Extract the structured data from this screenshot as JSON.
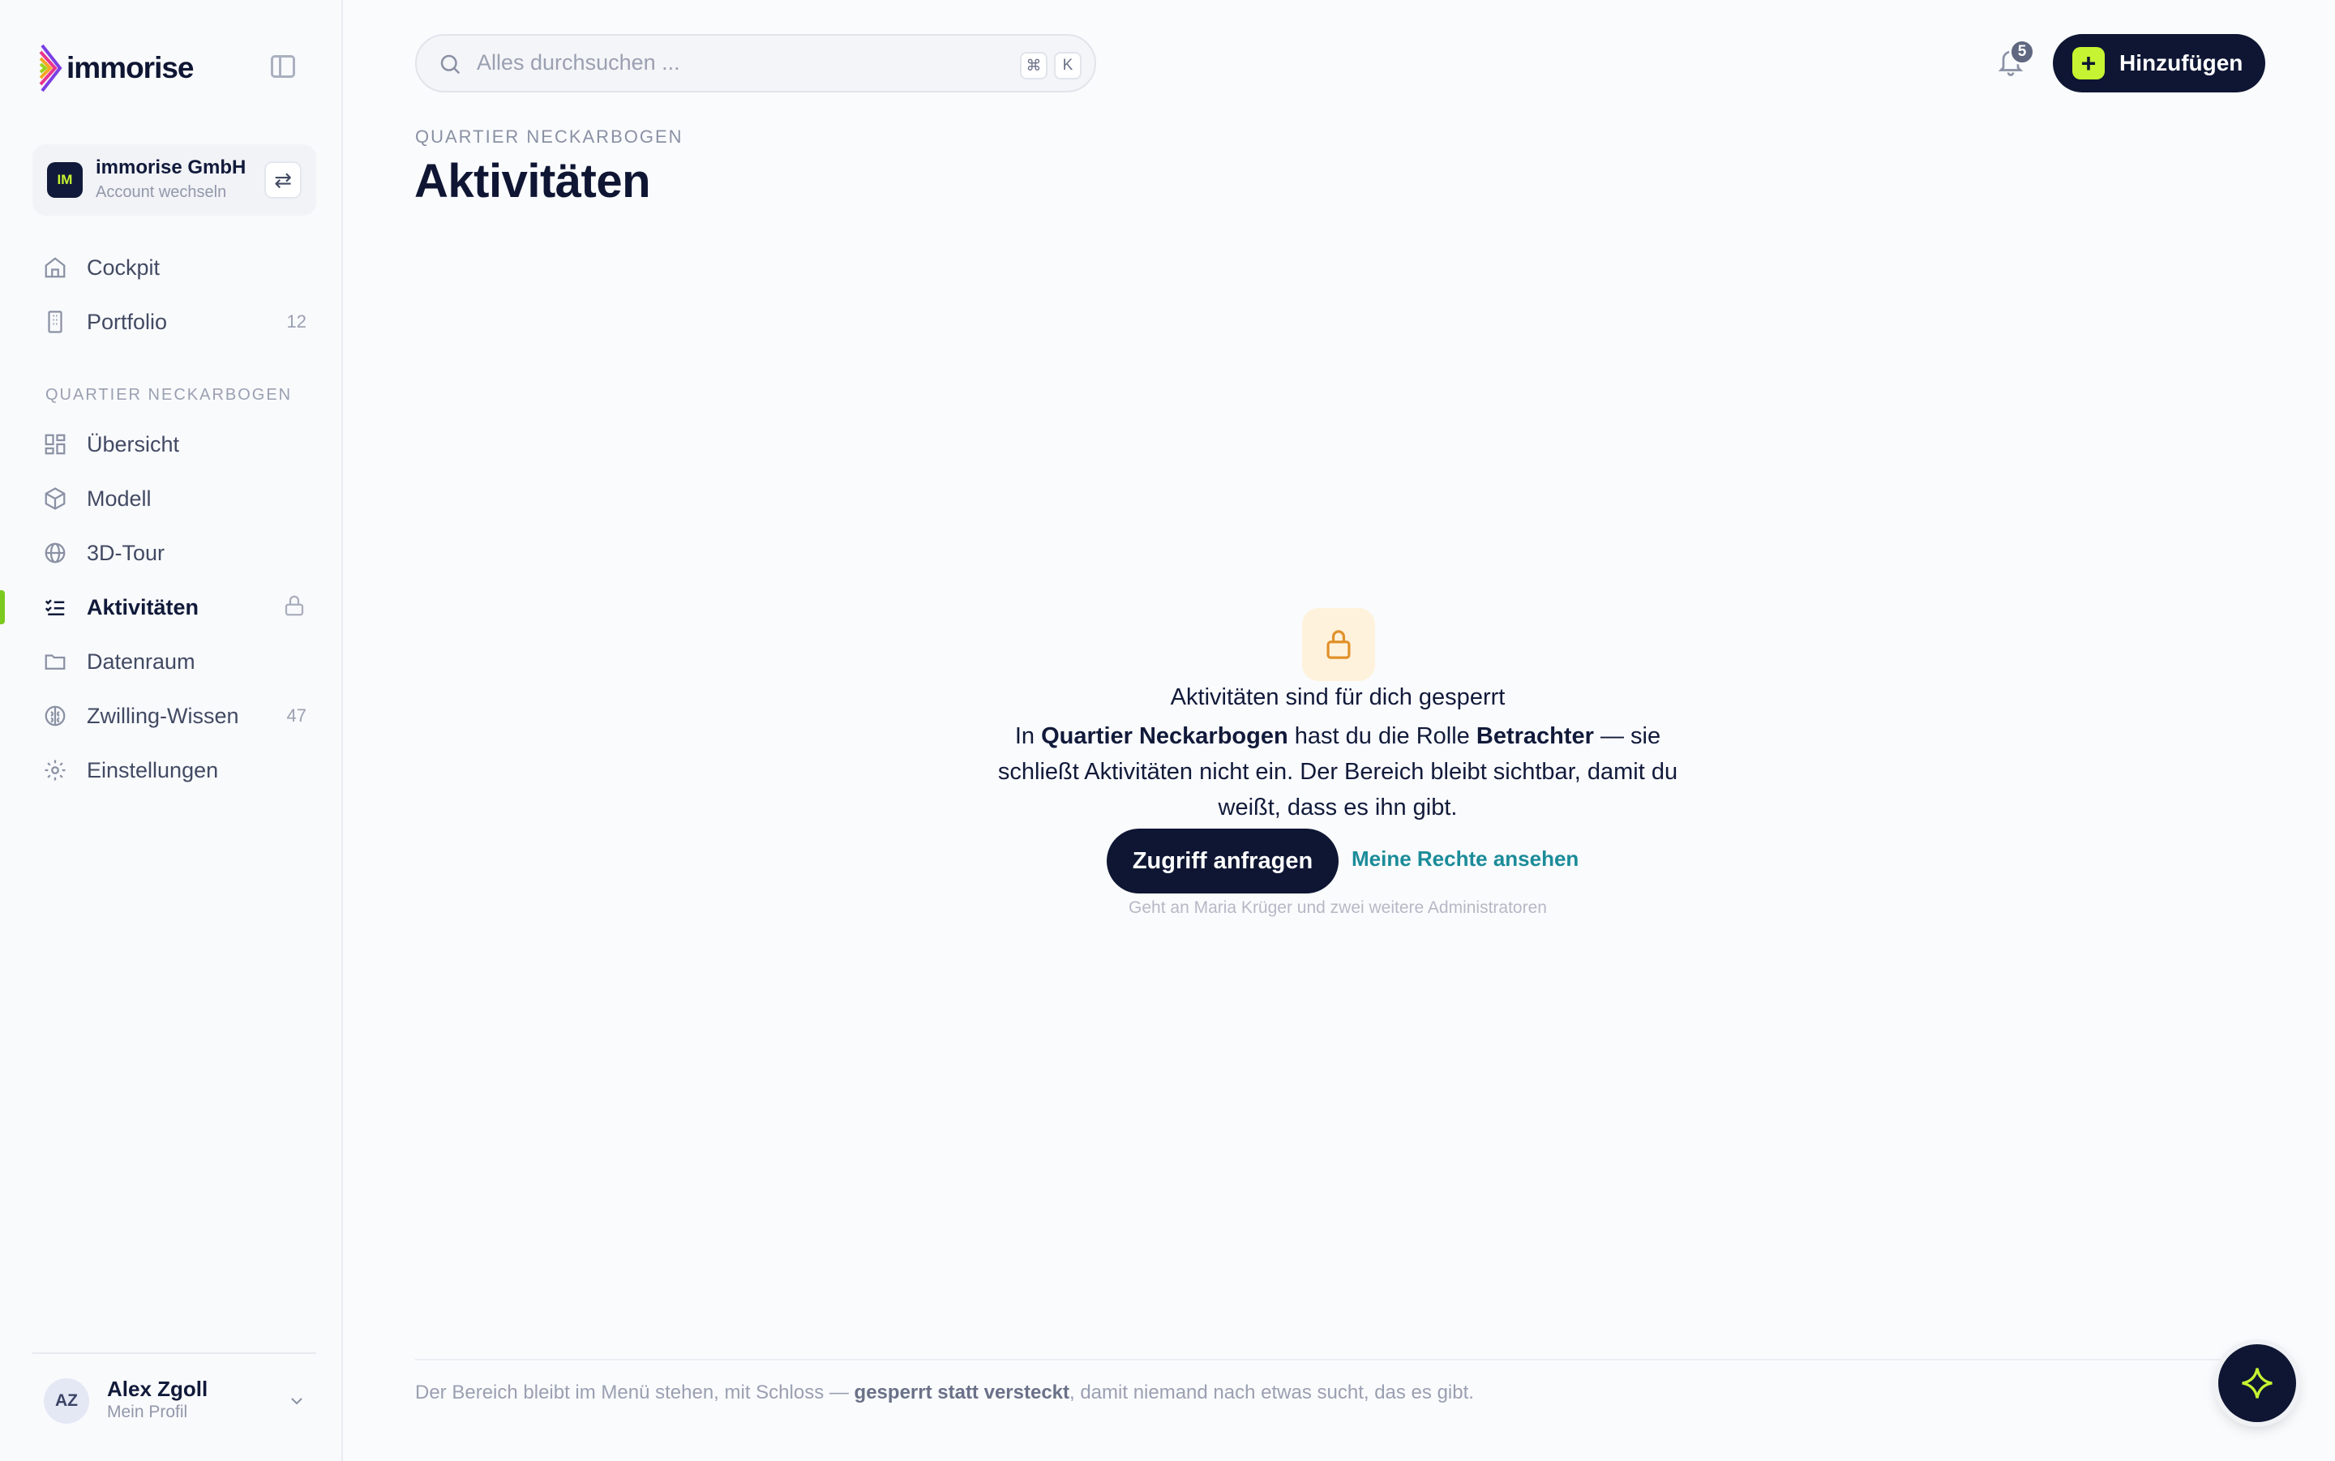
{
  "brand": {
    "name": "immorise"
  },
  "account": {
    "avatar_initials": "IM",
    "name": "immorise GmbH",
    "subtitle": "Account wechseln"
  },
  "nav": {
    "primary": [
      {
        "label": "Cockpit",
        "icon": "home-icon"
      },
      {
        "label": "Portfolio",
        "icon": "building-icon",
        "count": "12"
      }
    ],
    "section_title": "QUARTIER NECKARBOGEN",
    "section": [
      {
        "label": "Übersicht",
        "icon": "grid-icon"
      },
      {
        "label": "Modell",
        "icon": "cube-icon"
      },
      {
        "label": "3D-Tour",
        "icon": "globe-icon"
      },
      {
        "label": "Aktivitäten",
        "icon": "checklist-icon",
        "active": true,
        "locked": true
      },
      {
        "label": "Datenraum",
        "icon": "folder-icon"
      },
      {
        "label": "Zwilling-Wissen",
        "icon": "brain-icon",
        "count": "47"
      },
      {
        "label": "Einstellungen",
        "icon": "gear-icon"
      }
    ]
  },
  "user": {
    "initials": "AZ",
    "name": "Alex Zgoll",
    "subtitle": "Mein Profil"
  },
  "topbar": {
    "search_placeholder": "Alles durchsuchen ...",
    "shortcut_keys": [
      "⌘",
      "K"
    ],
    "notification_count": "5",
    "add_label": "Hinzufügen"
  },
  "page": {
    "breadcrumb": "QUARTIER NECKARBOGEN",
    "title": "Aktivitäten"
  },
  "locked": {
    "title": "Aktivitäten sind für dich gesperrt",
    "body_prefix": "In ",
    "body_place": "Quartier Neckarbogen",
    "body_mid": " hast du die Rolle ",
    "body_role": "Betrachter",
    "body_suffix": " — sie schließt Aktivitäten nicht ein. Der Bereich bleibt sichtbar, damit du weißt, dass es ihn gibt.",
    "request_button": "Zugriff anfragen",
    "rights_link": "Meine Rechte ansehen",
    "note": "Geht an Maria Krüger und zwei weitere Administratoren"
  },
  "footer": {
    "prefix": "Der Bereich bleibt im Menü stehen, mit Schloss — ",
    "bold": "gesperrt statt versteckt",
    "suffix": ", damit niemand nach etwas sucht, das es gibt."
  },
  "colors": {
    "navy": "#0e1633",
    "lime": "#c6f432",
    "active_bar": "#7cc91f",
    "link": "#1b8c99",
    "lock_tile": "#fff2dc",
    "lock_icon": "#e0912a"
  }
}
